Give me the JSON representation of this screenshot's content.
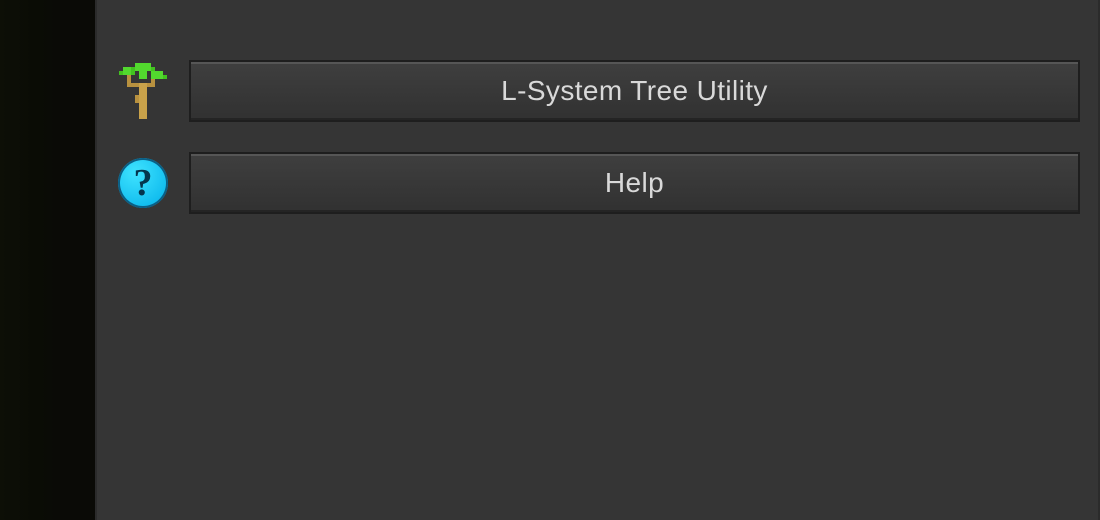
{
  "menu": {
    "items": [
      {
        "icon": "tree",
        "label": "L-System Tree Utility"
      },
      {
        "icon": "help",
        "label": "Help",
        "badge_glyph": "?"
      }
    ]
  },
  "colors": {
    "panel": "#353535",
    "button_text": "#d9d9d9",
    "help_circle": "#00b4ec",
    "tree_leaf": "#52d82e",
    "tree_trunk": "#c9a24a"
  }
}
